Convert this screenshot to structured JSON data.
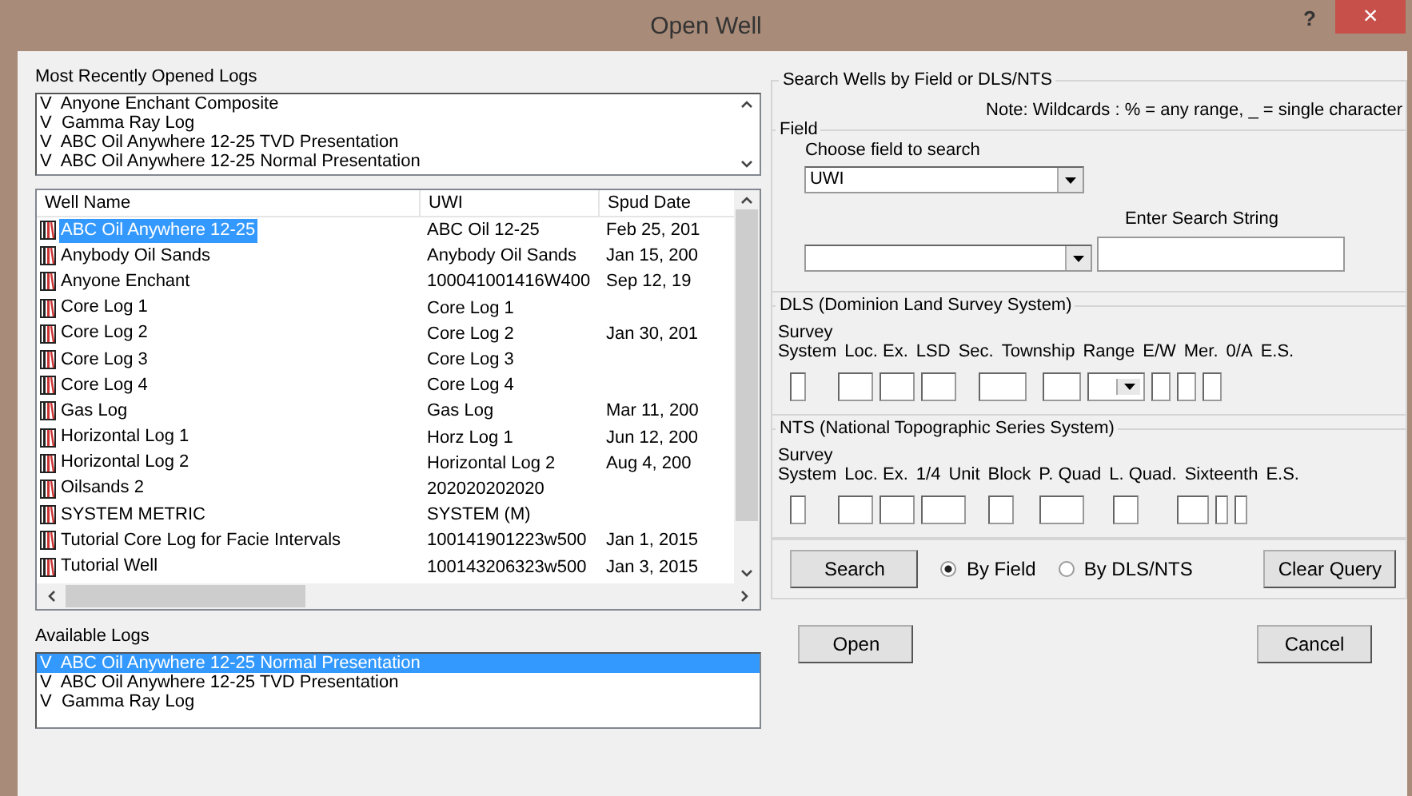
{
  "window": {
    "title": "Open Well",
    "help": "?",
    "close": "×"
  },
  "recent_logs": {
    "label": "Most Recently Opened Logs",
    "items": [
      {
        "mark": "V",
        "name": "Anyone Enchant Composite"
      },
      {
        "mark": "V",
        "name": "Gamma Ray Log"
      },
      {
        "mark": "V",
        "name": "ABC Oil Anywhere 12-25 TVD Presentation"
      },
      {
        "mark": "V",
        "name": "ABC Oil Anywhere 12-25 Normal Presentation"
      }
    ]
  },
  "wells_table": {
    "columns": [
      "Well Name",
      "UWI",
      "Spud Date"
    ],
    "rows": [
      {
        "cells": [
          "ABC Oil Anywhere 12-25",
          "ABC Oil 12-25",
          "Feb 25, 201"
        ],
        "selected": true
      },
      {
        "cells": [
          "Anybody Oil Sands",
          "Anybody Oil Sands",
          "Jan 15, 200"
        ],
        "selected": false
      },
      {
        "cells": [
          "Anyone Enchant",
          "100041001416W400",
          "Sep 12, 19"
        ],
        "selected": false
      },
      {
        "cells": [
          "Core Log 1",
          "Core Log 1",
          ""
        ],
        "selected": false
      },
      {
        "cells": [
          "Core Log 2",
          "Core Log 2",
          "Jan 30, 201"
        ],
        "selected": false
      },
      {
        "cells": [
          "Core Log 3",
          "Core Log 3",
          ""
        ],
        "selected": false
      },
      {
        "cells": [
          "Core Log 4",
          "Core Log 4",
          ""
        ],
        "selected": false
      },
      {
        "cells": [
          "Gas Log",
          "Gas Log",
          "Mar 11, 200"
        ],
        "selected": false
      },
      {
        "cells": [
          "Horizontal Log 1",
          "Horz Log 1",
          "Jun 12, 200"
        ],
        "selected": false
      },
      {
        "cells": [
          "Horizontal Log 2",
          "Horizontal Log 2",
          "Aug 4, 200"
        ],
        "selected": false
      },
      {
        "cells": [
          "Oilsands 2",
          "202020202020",
          ""
        ],
        "selected": false
      },
      {
        "cells": [
          "SYSTEM METRIC",
          "SYSTEM (M)",
          ""
        ],
        "selected": false
      },
      {
        "cells": [
          "Tutorial Core Log for Facie Intervals",
          "100141901223w500",
          "Jan 1, 2015"
        ],
        "selected": false
      },
      {
        "cells": [
          "Tutorial Well",
          "100143206323w500",
          "Jan 3, 2015"
        ],
        "selected": false
      }
    ]
  },
  "available_logs": {
    "label": "Available Logs",
    "items": [
      {
        "mark": "V",
        "name": "ABC Oil Anywhere 12-25 Normal Presentation",
        "selected": true
      },
      {
        "mark": "V",
        "name": "ABC Oil Anywhere 12-25 TVD Presentation",
        "selected": false
      },
      {
        "mark": "V",
        "name": "Gamma Ray Log",
        "selected": false
      }
    ]
  },
  "search": {
    "title": "Search Wells by Field or DLS/NTS",
    "note": "Note: Wildcards : % = any range, _ = single character",
    "field": {
      "title": "Field",
      "choose_label": "Choose field to search",
      "field_value": "UWI",
      "search_string_label": "Enter Search String"
    },
    "dls": {
      "title": "DLS (Dominion Land Survey System)",
      "survey_label": "Survey",
      "columns": [
        "System",
        "Loc. Ex.",
        "LSD",
        "Sec.",
        "Township",
        "Range",
        "E/W",
        "Mer.",
        "0/A",
        "E.S."
      ],
      "inputs": [
        {
          "kind": "box"
        },
        {
          "kind": "box"
        },
        {
          "kind": "box"
        },
        {
          "kind": "box"
        },
        {
          "kind": "box"
        },
        {
          "kind": "box"
        },
        {
          "kind": "dropdown"
        },
        {
          "kind": "box"
        },
        {
          "kind": "box"
        },
        {
          "kind": "box"
        }
      ]
    },
    "nts": {
      "title": "NTS (National Topographic Series System)",
      "survey_label": "Survey",
      "columns": [
        "System",
        "Loc. Ex.",
        "1/4",
        "Unit",
        "Block",
        "P. Quad",
        "L. Quad.",
        "Sixteenth",
        "E.S."
      ],
      "inputs": [
        {
          "kind": "box"
        },
        {
          "kind": "box"
        },
        {
          "kind": "box"
        },
        {
          "kind": "box"
        },
        {
          "kind": "box"
        },
        {
          "kind": "box"
        },
        {
          "kind": "box"
        },
        {
          "kind": "box"
        },
        {
          "kind": "box"
        },
        {
          "kind": "box"
        }
      ]
    },
    "search_button": "Search",
    "modes": [
      {
        "label": "By Field",
        "selected": true
      },
      {
        "label": "By DLS/NTS",
        "selected": false
      }
    ],
    "clear_button": "Clear Query"
  },
  "buttons": {
    "open": "Open",
    "cancel": "Cancel"
  }
}
